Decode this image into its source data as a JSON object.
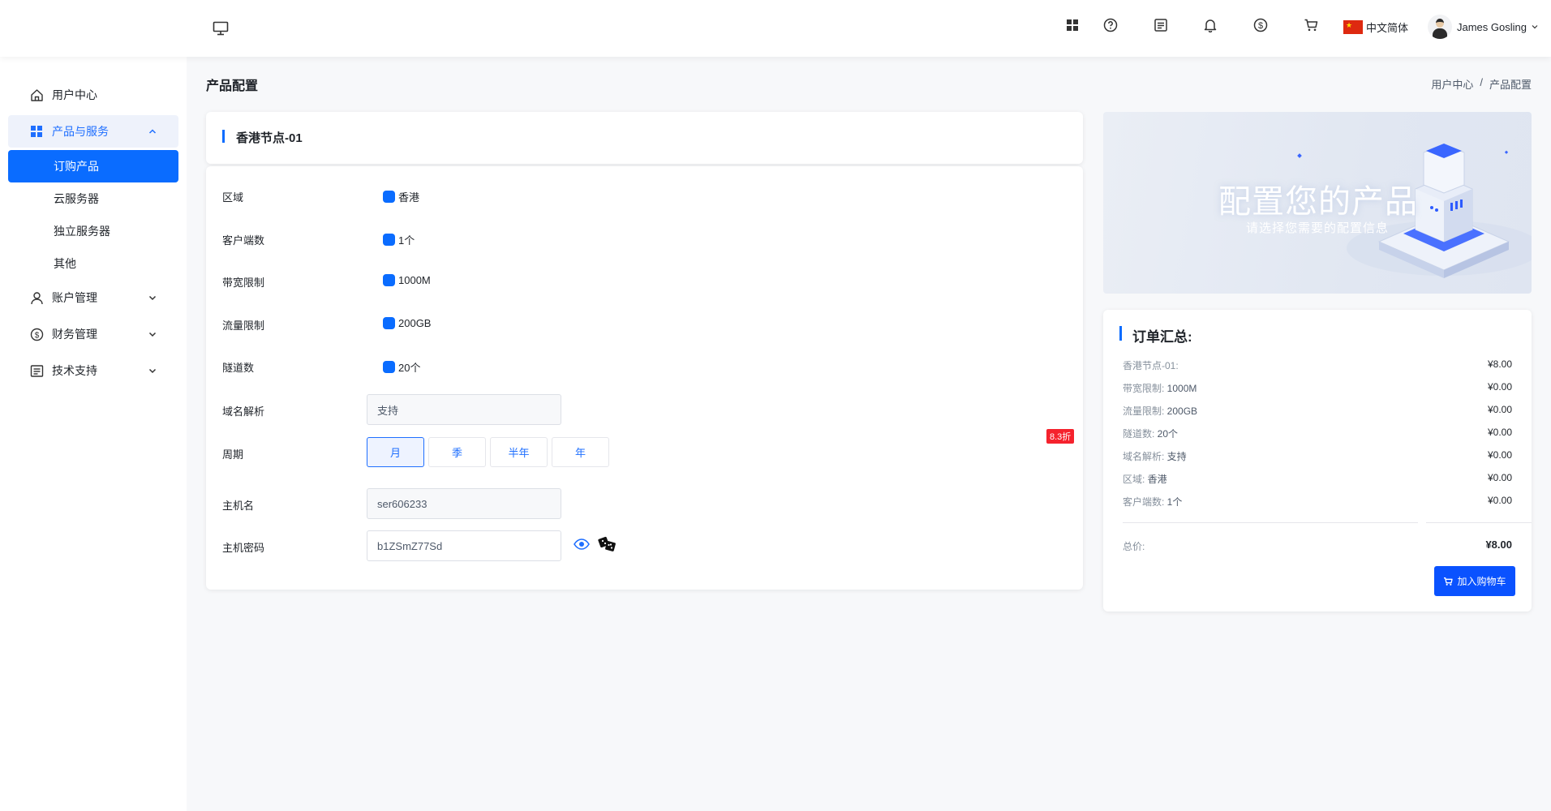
{
  "header": {
    "language": "中文简体",
    "user_name": "James Gosling",
    "icons": [
      "monitor-icon",
      "apps-grid-icon",
      "help-icon",
      "notes-icon",
      "bell-icon",
      "dollar-icon",
      "cart-icon",
      "china-flag-icon",
      "user-avatar"
    ]
  },
  "sidebar": {
    "items": [
      {
        "label": "用户中心",
        "icon": "home-icon"
      },
      {
        "label": "产品与服务",
        "icon": "grid-icon",
        "expanded": true,
        "children": [
          {
            "label": "订购产品",
            "active": true
          },
          {
            "label": "云服务器"
          },
          {
            "label": "独立服务器"
          },
          {
            "label": "其他"
          }
        ]
      },
      {
        "label": "账户管理",
        "icon": "user-icon"
      },
      {
        "label": "财务管理",
        "icon": "dollar-icon"
      },
      {
        "label": "技术支持",
        "icon": "document-icon"
      }
    ]
  },
  "page": {
    "title": "产品配置",
    "breadcrumb": [
      "用户中心",
      "/",
      "产品配置"
    ]
  },
  "product": {
    "name": "香港节点-01"
  },
  "form": {
    "rows": [
      {
        "label": "区域",
        "value": "香港"
      },
      {
        "label": "客户端数",
        "value": "1个"
      },
      {
        "label": "带宽限制",
        "value": "1000M"
      },
      {
        "label": "流量限制",
        "value": "200GB"
      },
      {
        "label": "隧道数",
        "value": "20个"
      }
    ],
    "dns": {
      "label": "域名解析",
      "value": "支持"
    },
    "period": {
      "label": "周期",
      "options": [
        "月",
        "季",
        "半年",
        "年"
      ],
      "selected": "月",
      "discount": "8.3折"
    },
    "hostname": {
      "label": "主机名",
      "value": "ser606233"
    },
    "password": {
      "label": "主机密码",
      "value": "b1ZSmZ77Sd"
    }
  },
  "banner": {
    "title": "配置您的产品",
    "subtitle": "请选择您需要的配置信息"
  },
  "summary": {
    "title": "订单汇总:",
    "rows": [
      {
        "key": "香港节点-01:",
        "detail": "",
        "price": "¥8.00"
      },
      {
        "key": "带宽限制: ",
        "detail": "1000M",
        "price": "¥0.00"
      },
      {
        "key": "流量限制: ",
        "detail": "200GB",
        "price": "¥0.00"
      },
      {
        "key": "隧道数: ",
        "detail": "20个",
        "price": "¥0.00"
      },
      {
        "key": "域名解析: ",
        "detail": "支持",
        "price": "¥0.00"
      },
      {
        "key": "区域: ",
        "detail": "香港",
        "price": "¥0.00"
      },
      {
        "key": "客户端数: ",
        "detail": "1个",
        "price": "¥0.00"
      }
    ],
    "total_label": "总价:",
    "total": "¥8.00",
    "cart_button": "加入购物车"
  },
  "colors": {
    "accent": "#0a6cff",
    "button": "#0a52ff",
    "discount": "#f5222d"
  }
}
